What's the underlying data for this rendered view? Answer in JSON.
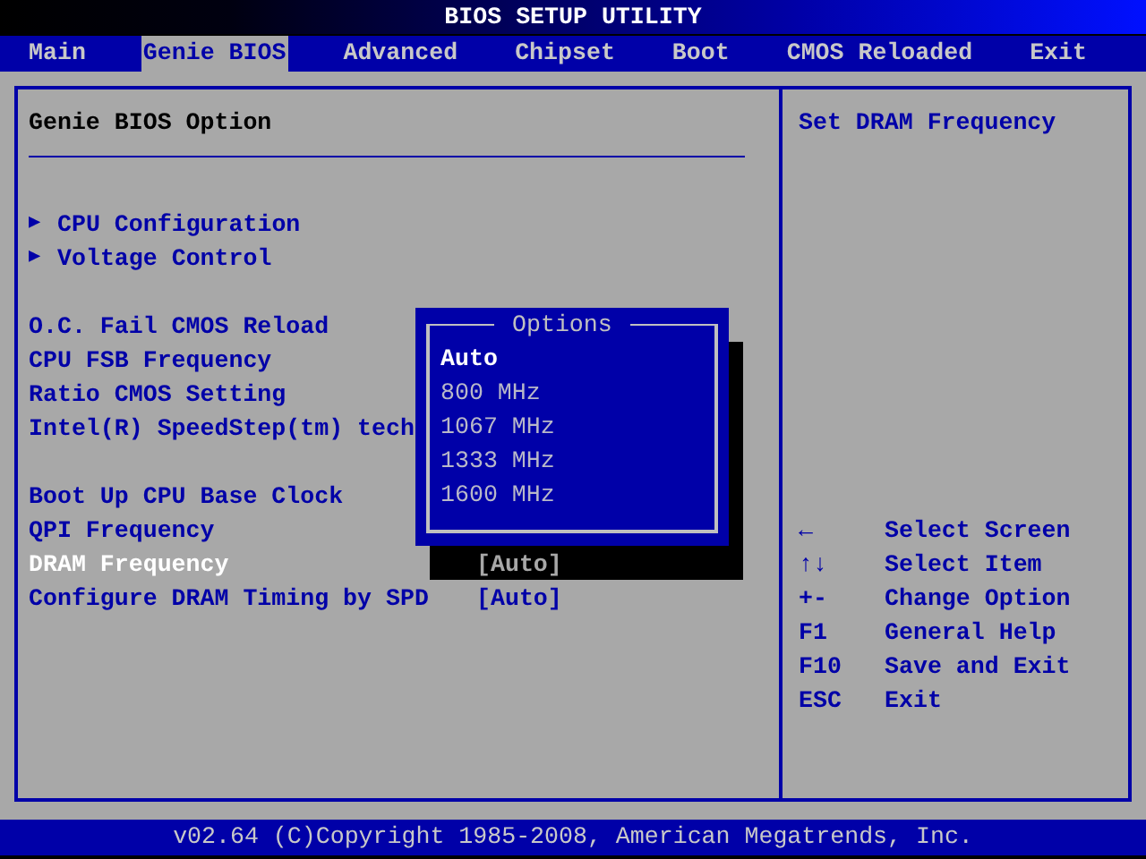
{
  "window": {
    "title": "BIOS SETUP UTILITY"
  },
  "tabs": [
    {
      "label": "Main",
      "selected": false
    },
    {
      "label": "Genie BIOS",
      "selected": true
    },
    {
      "label": "Advanced",
      "selected": false
    },
    {
      "label": "Chipset",
      "selected": false
    },
    {
      "label": "Boot",
      "selected": false
    },
    {
      "label": "CMOS Reloaded",
      "selected": false
    },
    {
      "label": "Exit",
      "selected": false
    }
  ],
  "panel": {
    "heading": "Genie BIOS Option",
    "groups": [
      [
        {
          "kind": "submenu",
          "marker": "▶",
          "label": "CPU Configuration",
          "selected": false
        },
        {
          "kind": "submenu",
          "marker": "▶",
          "label": "Voltage Control",
          "selected": false
        }
      ],
      [
        {
          "kind": "setting",
          "label": "O.C. Fail CMOS Reload",
          "selected": false
        },
        {
          "kind": "setting",
          "label": "CPU FSB Frequency",
          "selected": false
        },
        {
          "kind": "setting",
          "label": "Ratio CMOS Setting",
          "selected": false
        },
        {
          "kind": "setting",
          "label": "Intel(R) SpeedStep(tm) tech",
          "selected": false
        }
      ],
      [
        {
          "kind": "setting",
          "label": "Boot Up CPU Base Clock",
          "selected": false
        },
        {
          "kind": "setting",
          "label": "QPI Frequency",
          "selected": false
        },
        {
          "kind": "setting",
          "label": "DRAM Frequency",
          "value": "[Auto]",
          "selected": true
        },
        {
          "kind": "setting",
          "label": "Configure DRAM Timing by SPD",
          "value": "[Auto]",
          "selected": false
        }
      ]
    ]
  },
  "popup": {
    "title": "Options",
    "options": [
      {
        "label": "Auto",
        "selected": true
      },
      {
        "label": "800 MHz",
        "selected": false
      },
      {
        "label": "1067 MHz",
        "selected": false
      },
      {
        "label": "1333 MHz",
        "selected": false
      },
      {
        "label": "1600 MHz",
        "selected": false
      }
    ]
  },
  "help": {
    "text": "Set DRAM Frequency",
    "keys": [
      {
        "key": "←",
        "action": "Select Screen"
      },
      {
        "key": "↑↓",
        "action": "Select Item"
      },
      {
        "key": "+-",
        "action": "Change Option"
      },
      {
        "key": "F1",
        "action": "General Help"
      },
      {
        "key": "F10",
        "action": "Save and Exit"
      },
      {
        "key": "ESC",
        "action": "Exit"
      }
    ]
  },
  "status_bar": "v02.64 (C)Copyright 1985-2008, American Megatrends, Inc."
}
